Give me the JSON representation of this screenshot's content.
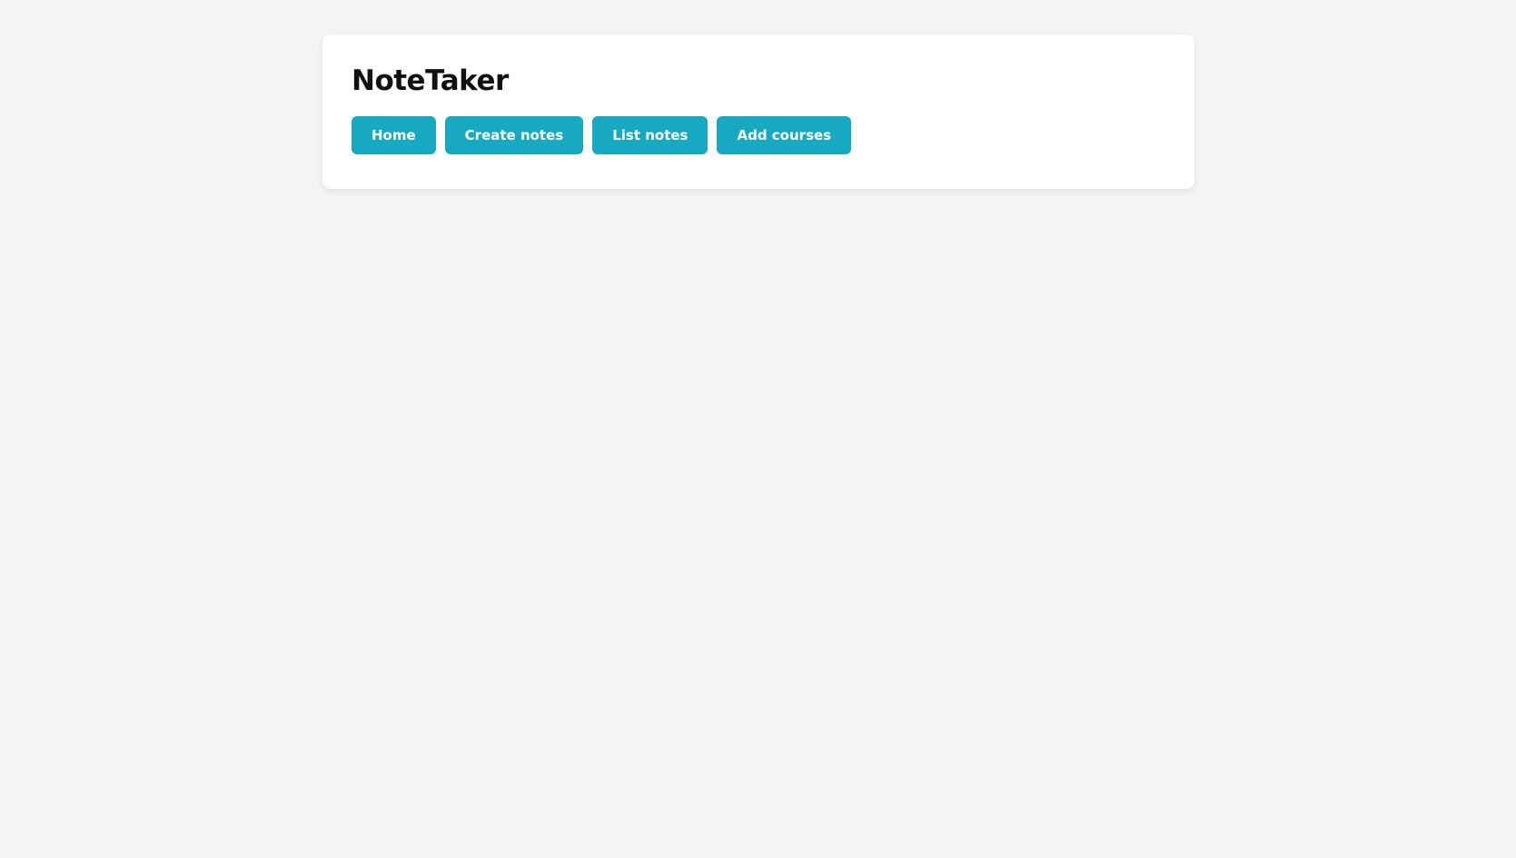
{
  "app": {
    "title": "NoteTaker"
  },
  "nav": {
    "items": [
      {
        "label": "Home"
      },
      {
        "label": "Create notes"
      },
      {
        "label": "List notes"
      },
      {
        "label": "Add courses"
      }
    ]
  },
  "colors": {
    "background": "#f4f4f4",
    "card": "#ffffff",
    "accent": "#18a9c2",
    "button_text": "#ffffff",
    "title_text": "#111111"
  }
}
